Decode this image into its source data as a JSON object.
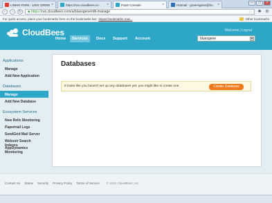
{
  "browser": {
    "tabs": [
      {
        "title": "LINKIN PARK - LIES GREED",
        "color": "#e23b2e"
      },
      {
        "title": "https://run.cloudbees.co",
        "color": "#2da6c8"
      },
      {
        "title": "PaaS Console",
        "color": "#2da6c8"
      },
      {
        "title": "Hotmail - greensgene@ho",
        "color": "#2f6fb9"
      }
    ],
    "url_scheme": "https://",
    "url_rest": "run.cloudbees.com/a/bluesgene#db-manage",
    "bookmarks_prompt": "For quick access, place your bookmarks here on the bookmarks bar.",
    "import_link": "Import bookmarks now...",
    "other_bookmarks": "Other bookmarks"
  },
  "header": {
    "logo": "CloudBees",
    "nav": [
      "Home",
      "Services",
      "Docs",
      "Support",
      "Account"
    ],
    "active_nav": "Services",
    "welcome": "Welcome",
    "logout": "Logout",
    "account_select": "bluesgene",
    "brand_color": "#2da6c8"
  },
  "sidebar": {
    "applications_title": "Applications",
    "applications": [
      "Manage",
      "Add New Application"
    ],
    "databases_title": "Databases",
    "databases": [
      "Manage",
      "Add New Database"
    ],
    "ecosystem_title": "Ecosystem Services",
    "ecosystem": [
      "New Relic Monitoring",
      "Papertrail Logs",
      "SendGrid Mail Server",
      "Websolr Search Indexes",
      "AppDynamics Monitoring"
    ]
  },
  "main": {
    "title": "Databases",
    "notice": "It looks like you haven't set up any databases yet, you might like to create one.",
    "create_button": "Create Database"
  },
  "footer": {
    "links": [
      "Contact Us",
      "Status",
      "Security",
      "Privacy Policy",
      "Terms of Service"
    ],
    "copyright": "© 2012 CloudBees, Inc."
  }
}
